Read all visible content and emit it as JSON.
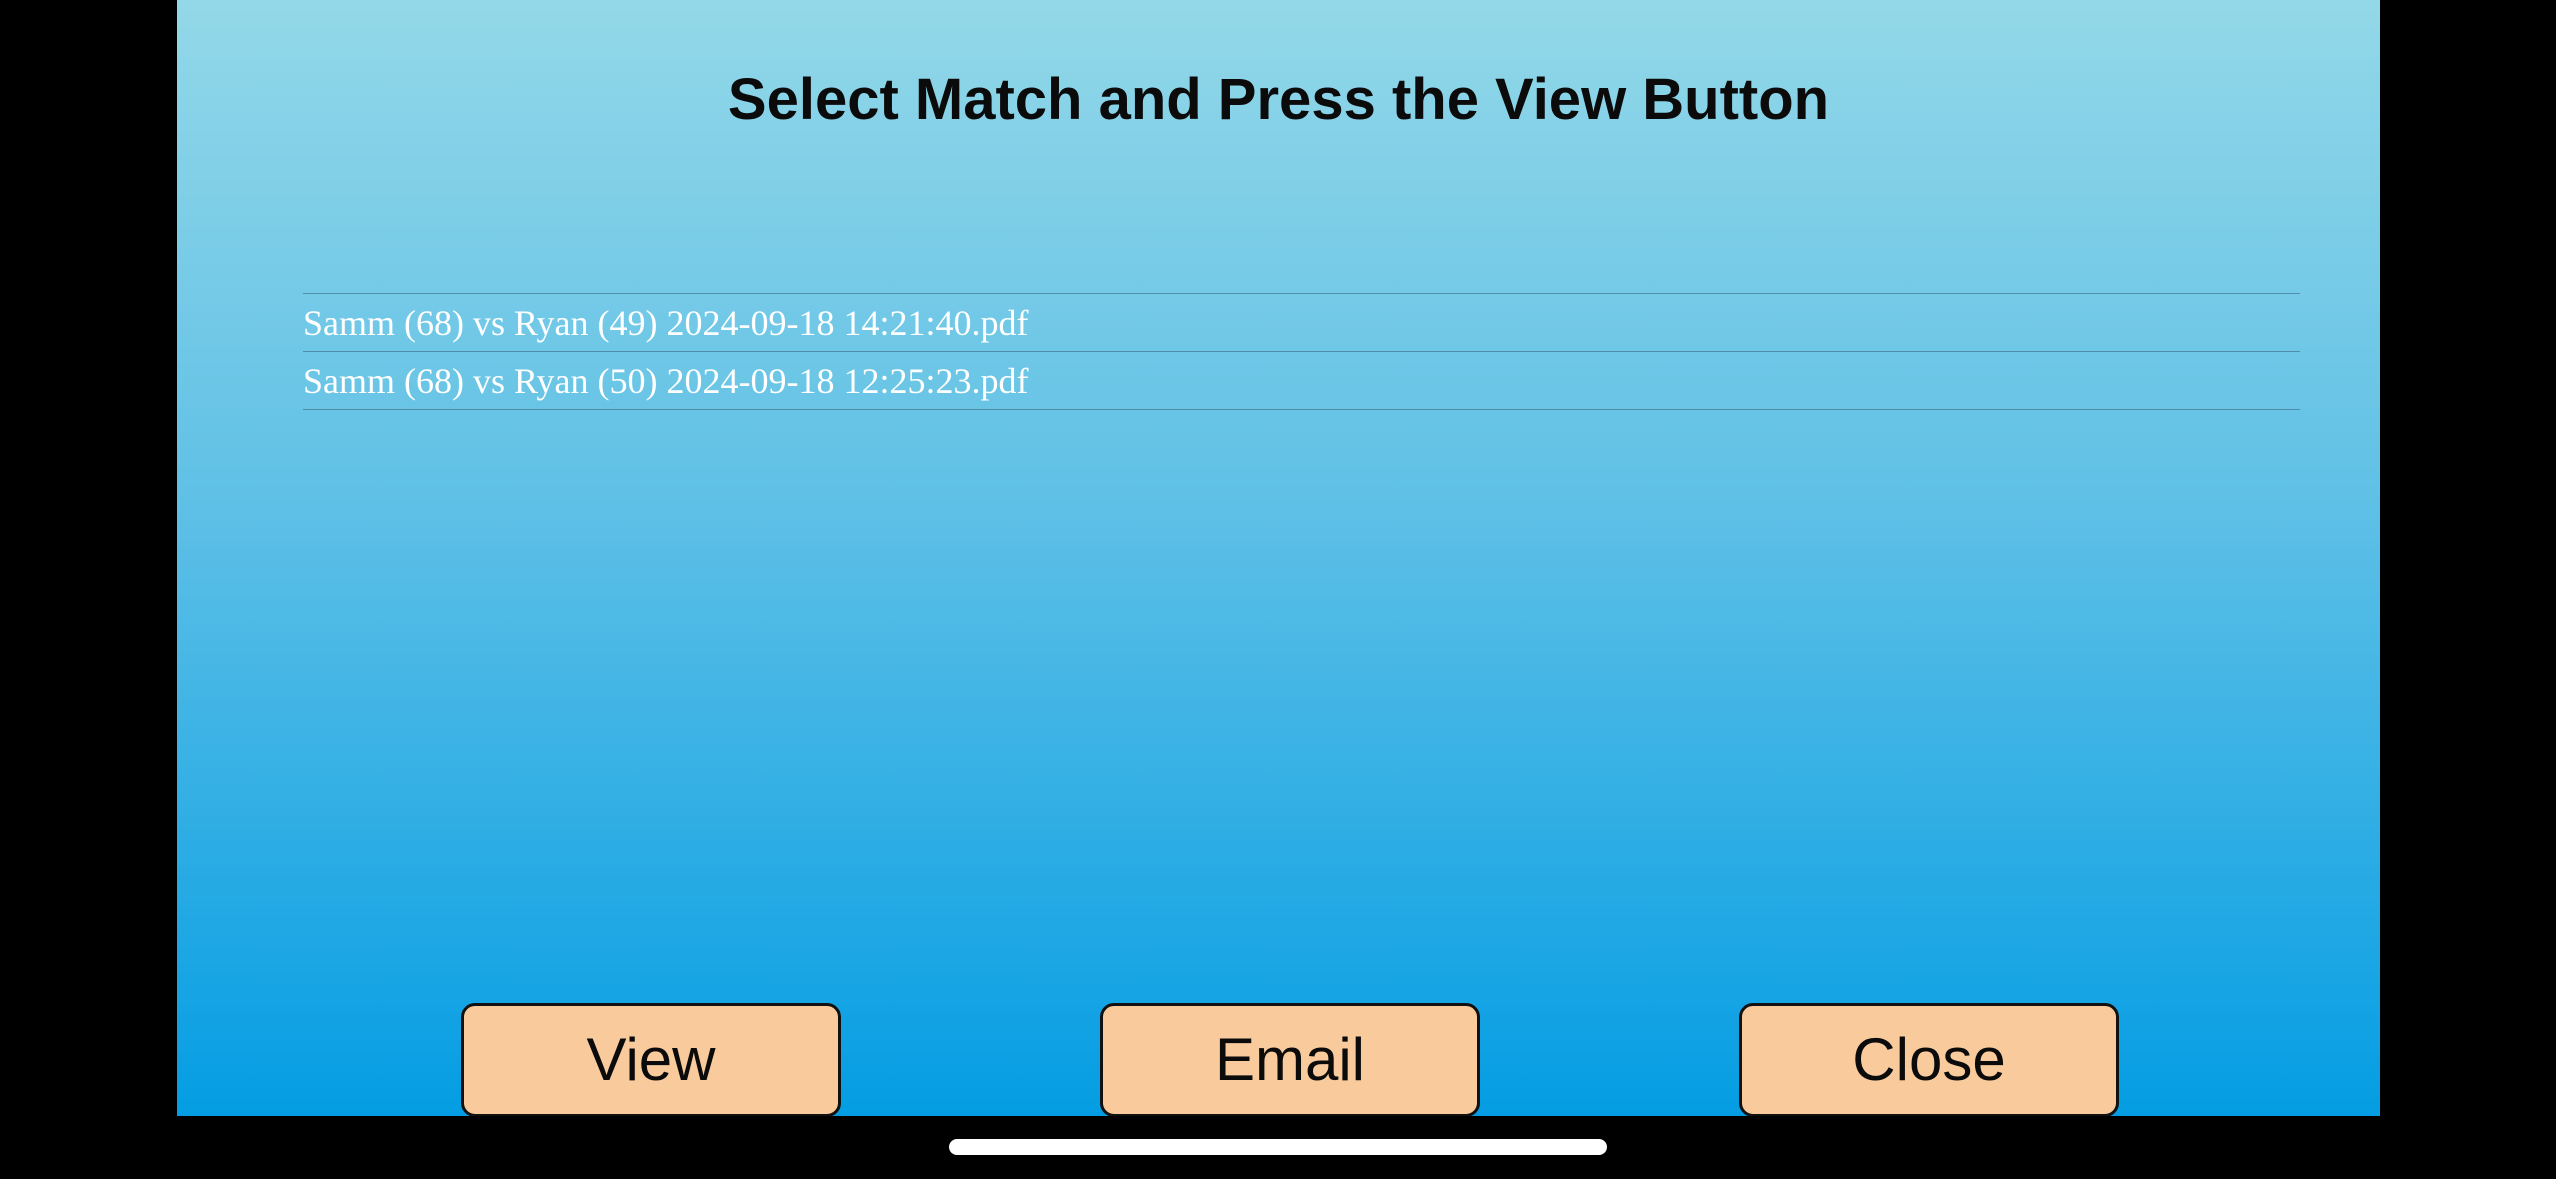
{
  "header": {
    "title": "Select Match and Press the View Button"
  },
  "files": [
    {
      "name": "Samm (68) vs Ryan (49) 2024-09-18 14:21:40.pdf"
    },
    {
      "name": "Samm (68) vs Ryan (50) 2024-09-18 12:25:23.pdf"
    }
  ],
  "actions": {
    "view_label": "View",
    "email_label": "Email",
    "close_label": "Close"
  },
  "colors": {
    "background_top": "#93d8e8",
    "background_bottom": "#049de3",
    "button_fill": "#f8ca9c",
    "list_text": "#ffffff"
  }
}
